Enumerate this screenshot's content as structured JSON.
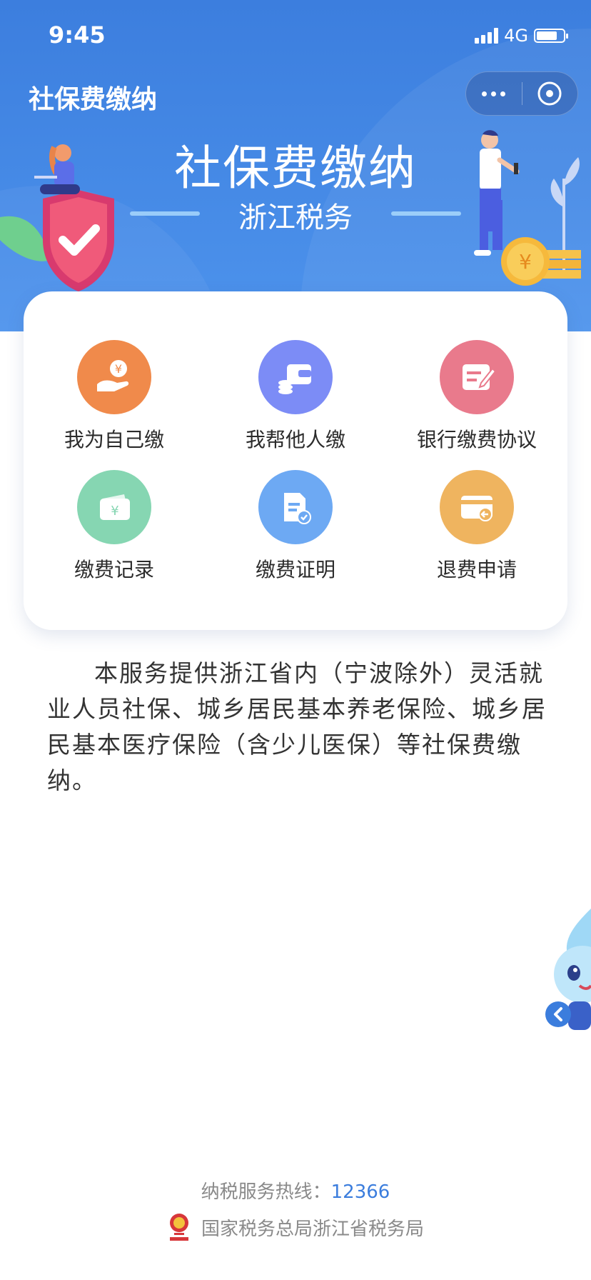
{
  "status_bar": {
    "time": "9:45",
    "network": "4G"
  },
  "nav": {
    "title": "社保费缴纳"
  },
  "hero": {
    "title": "社保费缴纳",
    "subtitle": "浙江税务"
  },
  "menu": [
    {
      "label": "我为自己缴",
      "icon": "hand-coin-icon",
      "color": "#f08a4b"
    },
    {
      "label": "我帮他人缴",
      "icon": "wallet-icon",
      "color": "#7c8cf6"
    },
    {
      "label": "银行缴费协议",
      "icon": "edit-document-icon",
      "color": "#e97a8c"
    },
    {
      "label": "缴费记录",
      "icon": "yuan-card-icon",
      "color": "#86d6b2"
    },
    {
      "label": "缴费证明",
      "icon": "certificate-icon",
      "color": "#6da9f3"
    },
    {
      "label": "退费申请",
      "icon": "refund-card-icon",
      "color": "#efb45f"
    }
  ],
  "description": "本服务提供浙江省内（宁波除外）灵活就业人员社保、城乡居民基本养老保险、城乡居民基本医疗保险（含少儿医保）等社保费缴纳。",
  "footer": {
    "hotline_label": "纳税服务热线：",
    "hotline_number": "12366",
    "org": "国家税务总局浙江省税务局"
  }
}
